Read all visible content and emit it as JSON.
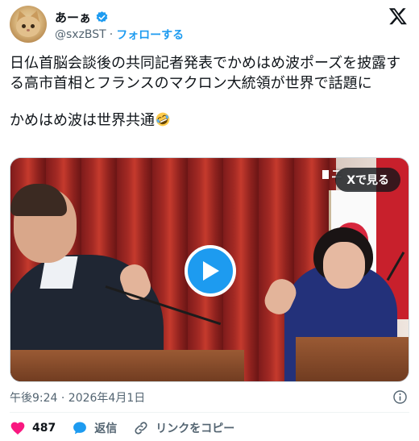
{
  "author": {
    "name": "あーぁ",
    "handle": "@sxzBST",
    "separator": "·",
    "follow_label": "フォローする"
  },
  "tweet": {
    "line1": "日仏首脳会談後の共同記者発表でかめはめ波ポーズを披露する高市首相とフランスのマクロン大統領が世界で話題に",
    "line2": "かめはめ波は世界共通"
  },
  "media": {
    "watch_on_x_label": "Xで見る",
    "corner_label": "ニ"
  },
  "meta": {
    "timestamp": "午後9:24 · 2026年4月1日"
  },
  "actions": {
    "like_count": "487",
    "reply_label": "返信",
    "copy_link_label": "リンクをコピー"
  },
  "colors": {
    "accent": "#1d9bf0",
    "like": "#f91880",
    "text_primary": "#0f1419",
    "text_secondary": "#536471"
  },
  "icons": [
    "verified-badge-icon",
    "x-logo-icon",
    "play-icon",
    "info-icon",
    "heart-icon",
    "reply-bubble-icon",
    "link-icon",
    "rofl-emoji-icon"
  ]
}
